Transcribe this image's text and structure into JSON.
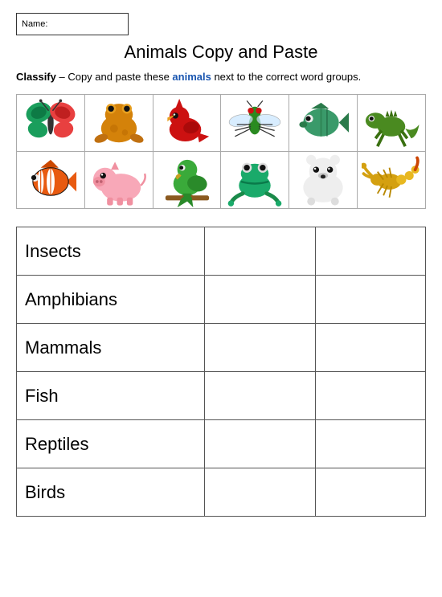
{
  "name_label": "Name:",
  "title": "Animals Copy and Paste",
  "instructions": {
    "bold": "Classify",
    "text": " – Copy and paste these ",
    "blue": "animals",
    "end": " next to the correct word groups."
  },
  "categories": [
    "Insects",
    "Amphibians",
    "Mammals",
    "Fish",
    "Reptiles",
    "Birds"
  ]
}
